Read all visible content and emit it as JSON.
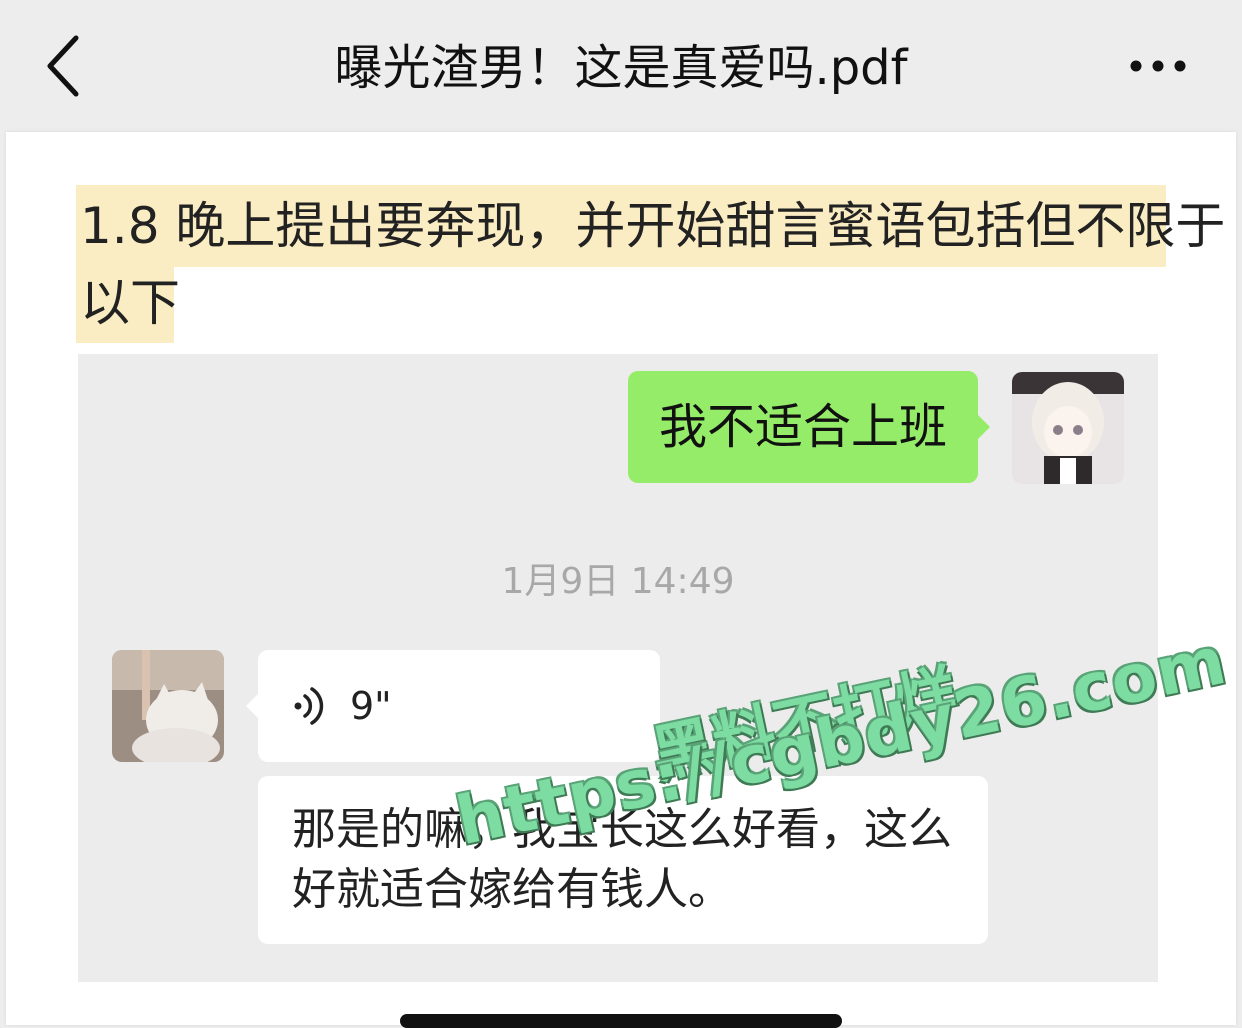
{
  "header": {
    "title": "曝光渣男！这是真爱吗.pdf",
    "back_icon": "chevron-left-icon",
    "more_icon": "more-dots-icon"
  },
  "document": {
    "highlight_color": "#fbedc3",
    "highlight_lines": [
      "1.8 晚上提出要奔现，并开始甜言蜜语包括但不限于",
      "以下"
    ]
  },
  "chat": {
    "sent_message": "我不适合上班",
    "timestamp": "1月9日 14:49",
    "voice_duration": "9\"",
    "received_text": "那是的嘛，我宝长这么好看，这么好就适合嫁给有钱人。",
    "sent_bubble_color": "#95ec69"
  },
  "watermark": {
    "line1": "黑料不打烊",
    "line2": "https://cgbdy26.com",
    "color": "#7ddca2"
  }
}
